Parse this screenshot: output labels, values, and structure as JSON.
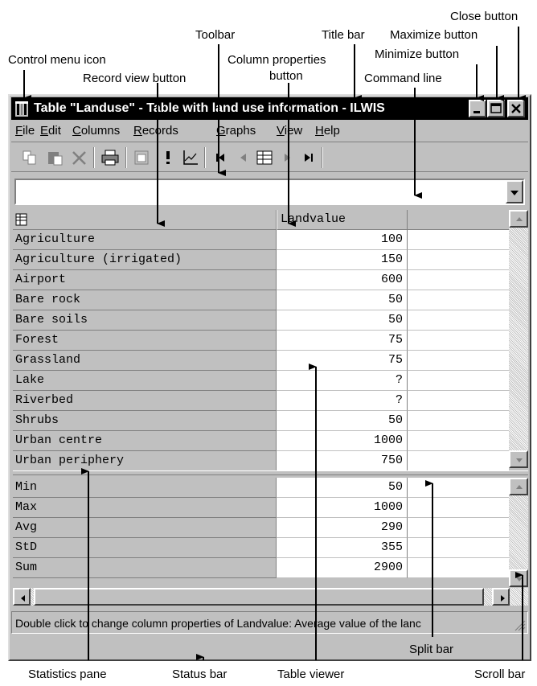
{
  "annotations": {
    "close_button": "Close button",
    "toolbar": "Toolbar",
    "title_bar": "Title bar",
    "maximize_button": "Maximize button",
    "control_menu_icon": "Control menu icon",
    "column_properties_button": "Column properties",
    "column_properties_button_2": "button",
    "minimize_button": "Minimize button",
    "record_view_button": "Record view button",
    "command_line": "Command line",
    "statistics_pane": "Statistics pane",
    "status_bar": "Status bar",
    "table_viewer": "Table viewer",
    "split_bar": "Split bar",
    "scroll_bar": "Scroll bar"
  },
  "window": {
    "title": "Table \"Landuse\" - Table with land use information - ILWIS"
  },
  "menu": [
    {
      "first": "F",
      "rest": "ile"
    },
    {
      "first": "E",
      "rest": "dit"
    },
    {
      "first": "C",
      "rest": "olumns"
    },
    {
      "first": "R",
      "rest": "ecords"
    },
    {
      "first": "G",
      "rest": "raphs"
    },
    {
      "first": "V",
      "rest": "iew"
    },
    {
      "first": "H",
      "rest": "elp"
    }
  ],
  "toolbar_icons": [
    "copy-icon",
    "paste-icon",
    "delete-icon",
    "print-icon",
    "properties-icon",
    "exclamation-icon",
    "graph-icon",
    "first-record-icon",
    "previous-record-icon",
    "record-view-icon",
    "next-record-icon",
    "last-record-icon"
  ],
  "command_line": {
    "value": ""
  },
  "table": {
    "column_header": "Landvalue",
    "rows": [
      {
        "name": "Agriculture",
        "value": "100"
      },
      {
        "name": "Agriculture (irrigated)",
        "value": "150"
      },
      {
        "name": "Airport",
        "value": "600"
      },
      {
        "name": "Bare rock",
        "value": "50"
      },
      {
        "name": "Bare soils",
        "value": "50"
      },
      {
        "name": "Forest",
        "value": "75"
      },
      {
        "name": "Grassland",
        "value": "75"
      },
      {
        "name": "Lake",
        "value": "?"
      },
      {
        "name": "Riverbed",
        "value": "?"
      },
      {
        "name": "Shrubs",
        "value": "50"
      },
      {
        "name": "Urban centre",
        "value": "1000"
      },
      {
        "name": "Urban periphery",
        "value": "750"
      }
    ]
  },
  "statistics": [
    {
      "name": "Min",
      "value": "50"
    },
    {
      "name": "Max",
      "value": "1000"
    },
    {
      "name": "Avg",
      "value": "290"
    },
    {
      "name": "StD",
      "value": "355"
    },
    {
      "name": "Sum",
      "value": "2900"
    }
  ],
  "status_bar": {
    "text": "Double click to change column properties of Landvalue: Average value of the lanc"
  }
}
